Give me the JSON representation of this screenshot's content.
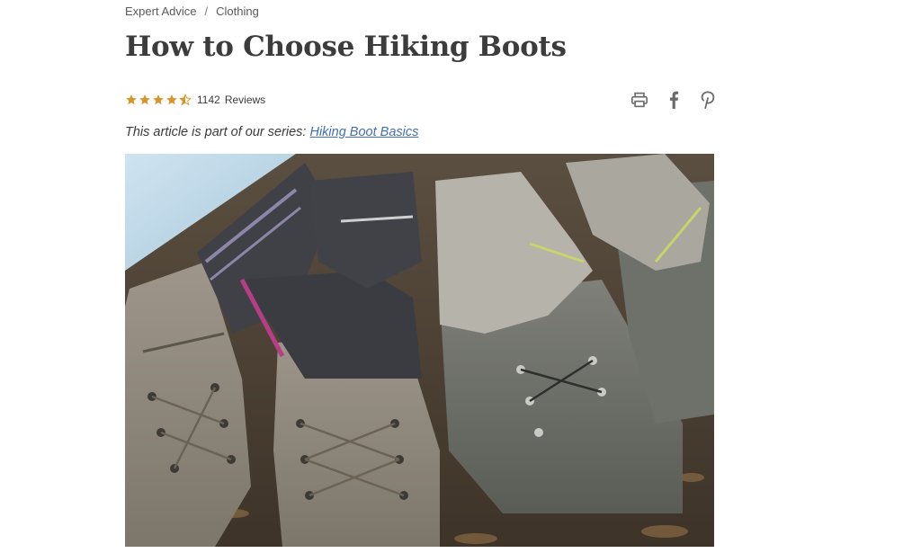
{
  "breadcrumb": {
    "items": [
      "Expert Advice",
      "Clothing"
    ],
    "separator": "/"
  },
  "article": {
    "title": "How to Choose Hiking Boots",
    "rating": {
      "stars": 4.5,
      "review_count": "1142",
      "reviews_label": "Reviews",
      "star_color": "#d7962a"
    },
    "series_prefix": "This article is part of our series:",
    "series_link": "Hiking Boot Basics",
    "hero_image": {
      "description": "hiking-boots-with-socks-photo"
    }
  },
  "share": {
    "icons": [
      "print-icon",
      "facebook-icon",
      "pinterest-icon"
    ],
    "icon_color": "#6b6b6b"
  },
  "colors": {
    "link": "#406eb5",
    "text": "#3b3b3b"
  }
}
